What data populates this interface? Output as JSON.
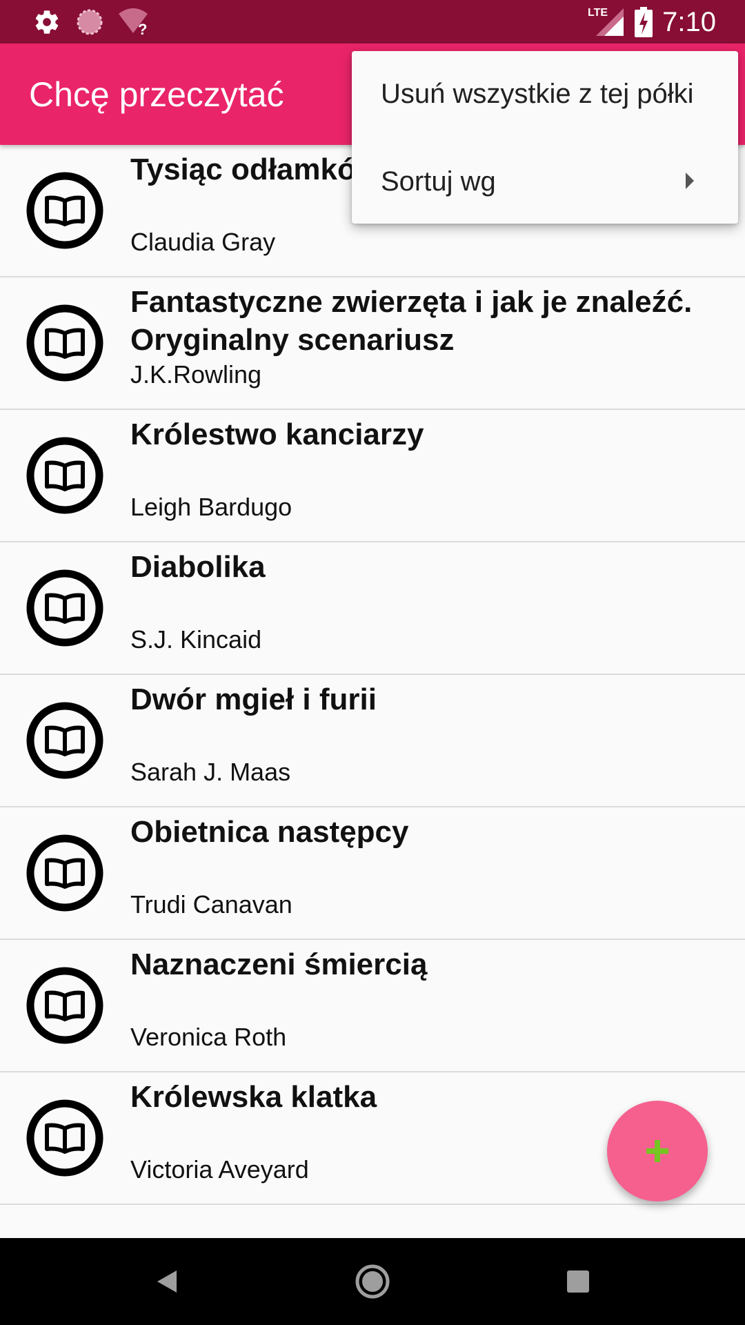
{
  "status_bar": {
    "time": "7:10",
    "network_label": "LTE",
    "icons": [
      "gear-icon",
      "sync-icon",
      "wifi-unknown-icon",
      "lte-signal-icon",
      "battery-charging-icon"
    ]
  },
  "app_bar": {
    "title": "Chcę przeczytać"
  },
  "menu": {
    "items": [
      {
        "label": "Usuń wszystkie z tej półki",
        "has_submenu": false
      },
      {
        "label": "Sortuj wg",
        "has_submenu": true
      }
    ]
  },
  "books": [
    {
      "title": "Tysiąc odłamków",
      "author": "Claudia Gray"
    },
    {
      "title": "Fantastyczne zwierzęta i jak je znaleźć. Oryginalny scenariusz",
      "author": "J.K.Rowling"
    },
    {
      "title": "Królestwo kanciarzy",
      "author": "Leigh Bardugo"
    },
    {
      "title": "Diabolika",
      "author": "S.J. Kincaid"
    },
    {
      "title": "Dwór mgieł i furii",
      "author": "Sarah J. Maas"
    },
    {
      "title": "Obietnica następcy",
      "author": "Trudi Canavan"
    },
    {
      "title": "Naznaczeni śmiercią",
      "author": "Veronica Roth"
    },
    {
      "title": "Królewska klatka",
      "author": "Victoria Aveyard"
    }
  ],
  "colors": {
    "status_bar": "#880e36",
    "app_bar": "#ea2469",
    "fab": "#f5608f",
    "fab_icon": "#76c522"
  }
}
